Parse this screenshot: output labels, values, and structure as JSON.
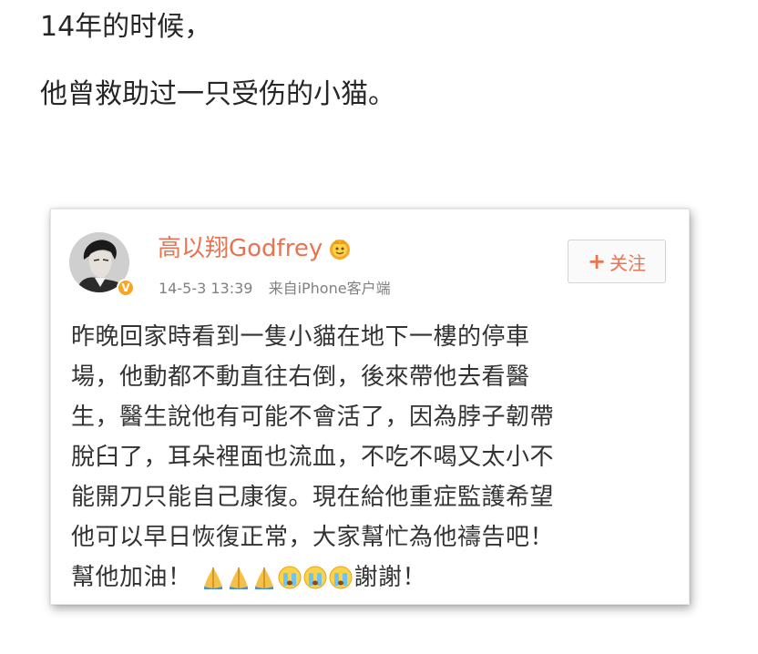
{
  "intro": {
    "line1": "14年的时候，",
    "line2": "他曾救助过一只受伤的小猫。"
  },
  "post": {
    "username": "高以翔Godfrey",
    "timestamp": "14-5-3 13:39",
    "source": "来自iPhone客户端",
    "follow_label": "关注",
    "follow_prefix": "+",
    "verified_badge": "V",
    "lines": [
      "昨晚回家時看到一隻小貓在地下一樓的停車",
      "場，他動都不動直往右倒，後來帶他去看醫",
      "生，醫生說他有可能不會活了，因為脖子韌帶",
      "脫臼了，耳朵裡面也流血，不吃不喝又太小不",
      "能開刀只能自己康復。現在給他重症監護希望",
      "他可以早日恢復正常，大家幫忙為他禱告吧！"
    ],
    "last_line_start": "幫他加油！",
    "last_line_end": "謝謝！",
    "emojis": [
      "praying-hands",
      "praying-hands",
      "praying-hands",
      "crying-face",
      "crying-face",
      "crying-face"
    ]
  },
  "colors": {
    "accent": "#eb7350",
    "meta": "#808080",
    "text": "#333333",
    "verified": "#f5a623"
  }
}
